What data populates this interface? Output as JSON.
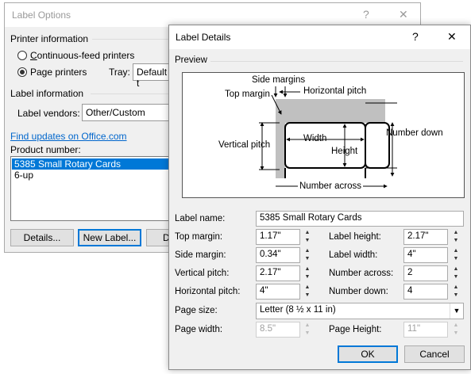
{
  "back": {
    "title": "Label Options",
    "help_glyph": "?",
    "close_glyph": "✕",
    "printer_section": "Printer information",
    "radio_continuous": "Continuous-feed printers",
    "radio_page": "Page printers",
    "tray_label": "Tray:",
    "tray_value": "Default t",
    "label_info_section": "Label information",
    "vendors_label": "Label vendors:",
    "vendors_value": "Other/Custom",
    "find_link": "Find updates on Office.com",
    "product_number_label": "Product number:",
    "products": [
      "5385 Small Rotary Cards",
      "6-up"
    ],
    "btn_details": "Details...",
    "btn_new_label": "New Label...",
    "btn_d": "D"
  },
  "front": {
    "title": "Label Details",
    "help_glyph": "?",
    "close_glyph": "✕",
    "preview_section": "Preview",
    "diagram": {
      "side_margins": "Side margins",
      "horizontal_pitch": "Horizontal pitch",
      "top_margin": "Top margin",
      "vertical_pitch": "Vertical pitch",
      "width": "Width",
      "height": "Height",
      "number_down": "Number down",
      "number_across": "Number across"
    },
    "label_name_label": "Label name:",
    "label_name_value": "5385 Small Rotary Cards",
    "fields": {
      "top_margin": {
        "label": "Top margin:",
        "value": "1.17\""
      },
      "label_height": {
        "label": "Label height:",
        "value": "2.17\""
      },
      "side_margin": {
        "label": "Side margin:",
        "value": "0.34\""
      },
      "label_width": {
        "label": "Label width:",
        "value": "4\""
      },
      "vertical_pitch": {
        "label": "Vertical pitch:",
        "value": "2.17\""
      },
      "number_across": {
        "label": "Number across:",
        "value": "2"
      },
      "horizontal_pitch": {
        "label": "Horizontal pitch:",
        "value": "4\""
      },
      "number_down": {
        "label": "Number down:",
        "value": "4"
      },
      "page_width": {
        "label": "Page width:",
        "value": "8.5\""
      },
      "page_height": {
        "label": "Page Height:",
        "value": "11\""
      }
    },
    "page_size_label": "Page size:",
    "page_size_value": "Letter (8 ½ x 11 in)",
    "btn_ok": "OK",
    "btn_cancel": "Cancel"
  },
  "colors": {
    "accent": "#0078d7",
    "selection": "#0078d7",
    "link": "#0066cc",
    "dialog_bg": "#f0f0f0"
  }
}
